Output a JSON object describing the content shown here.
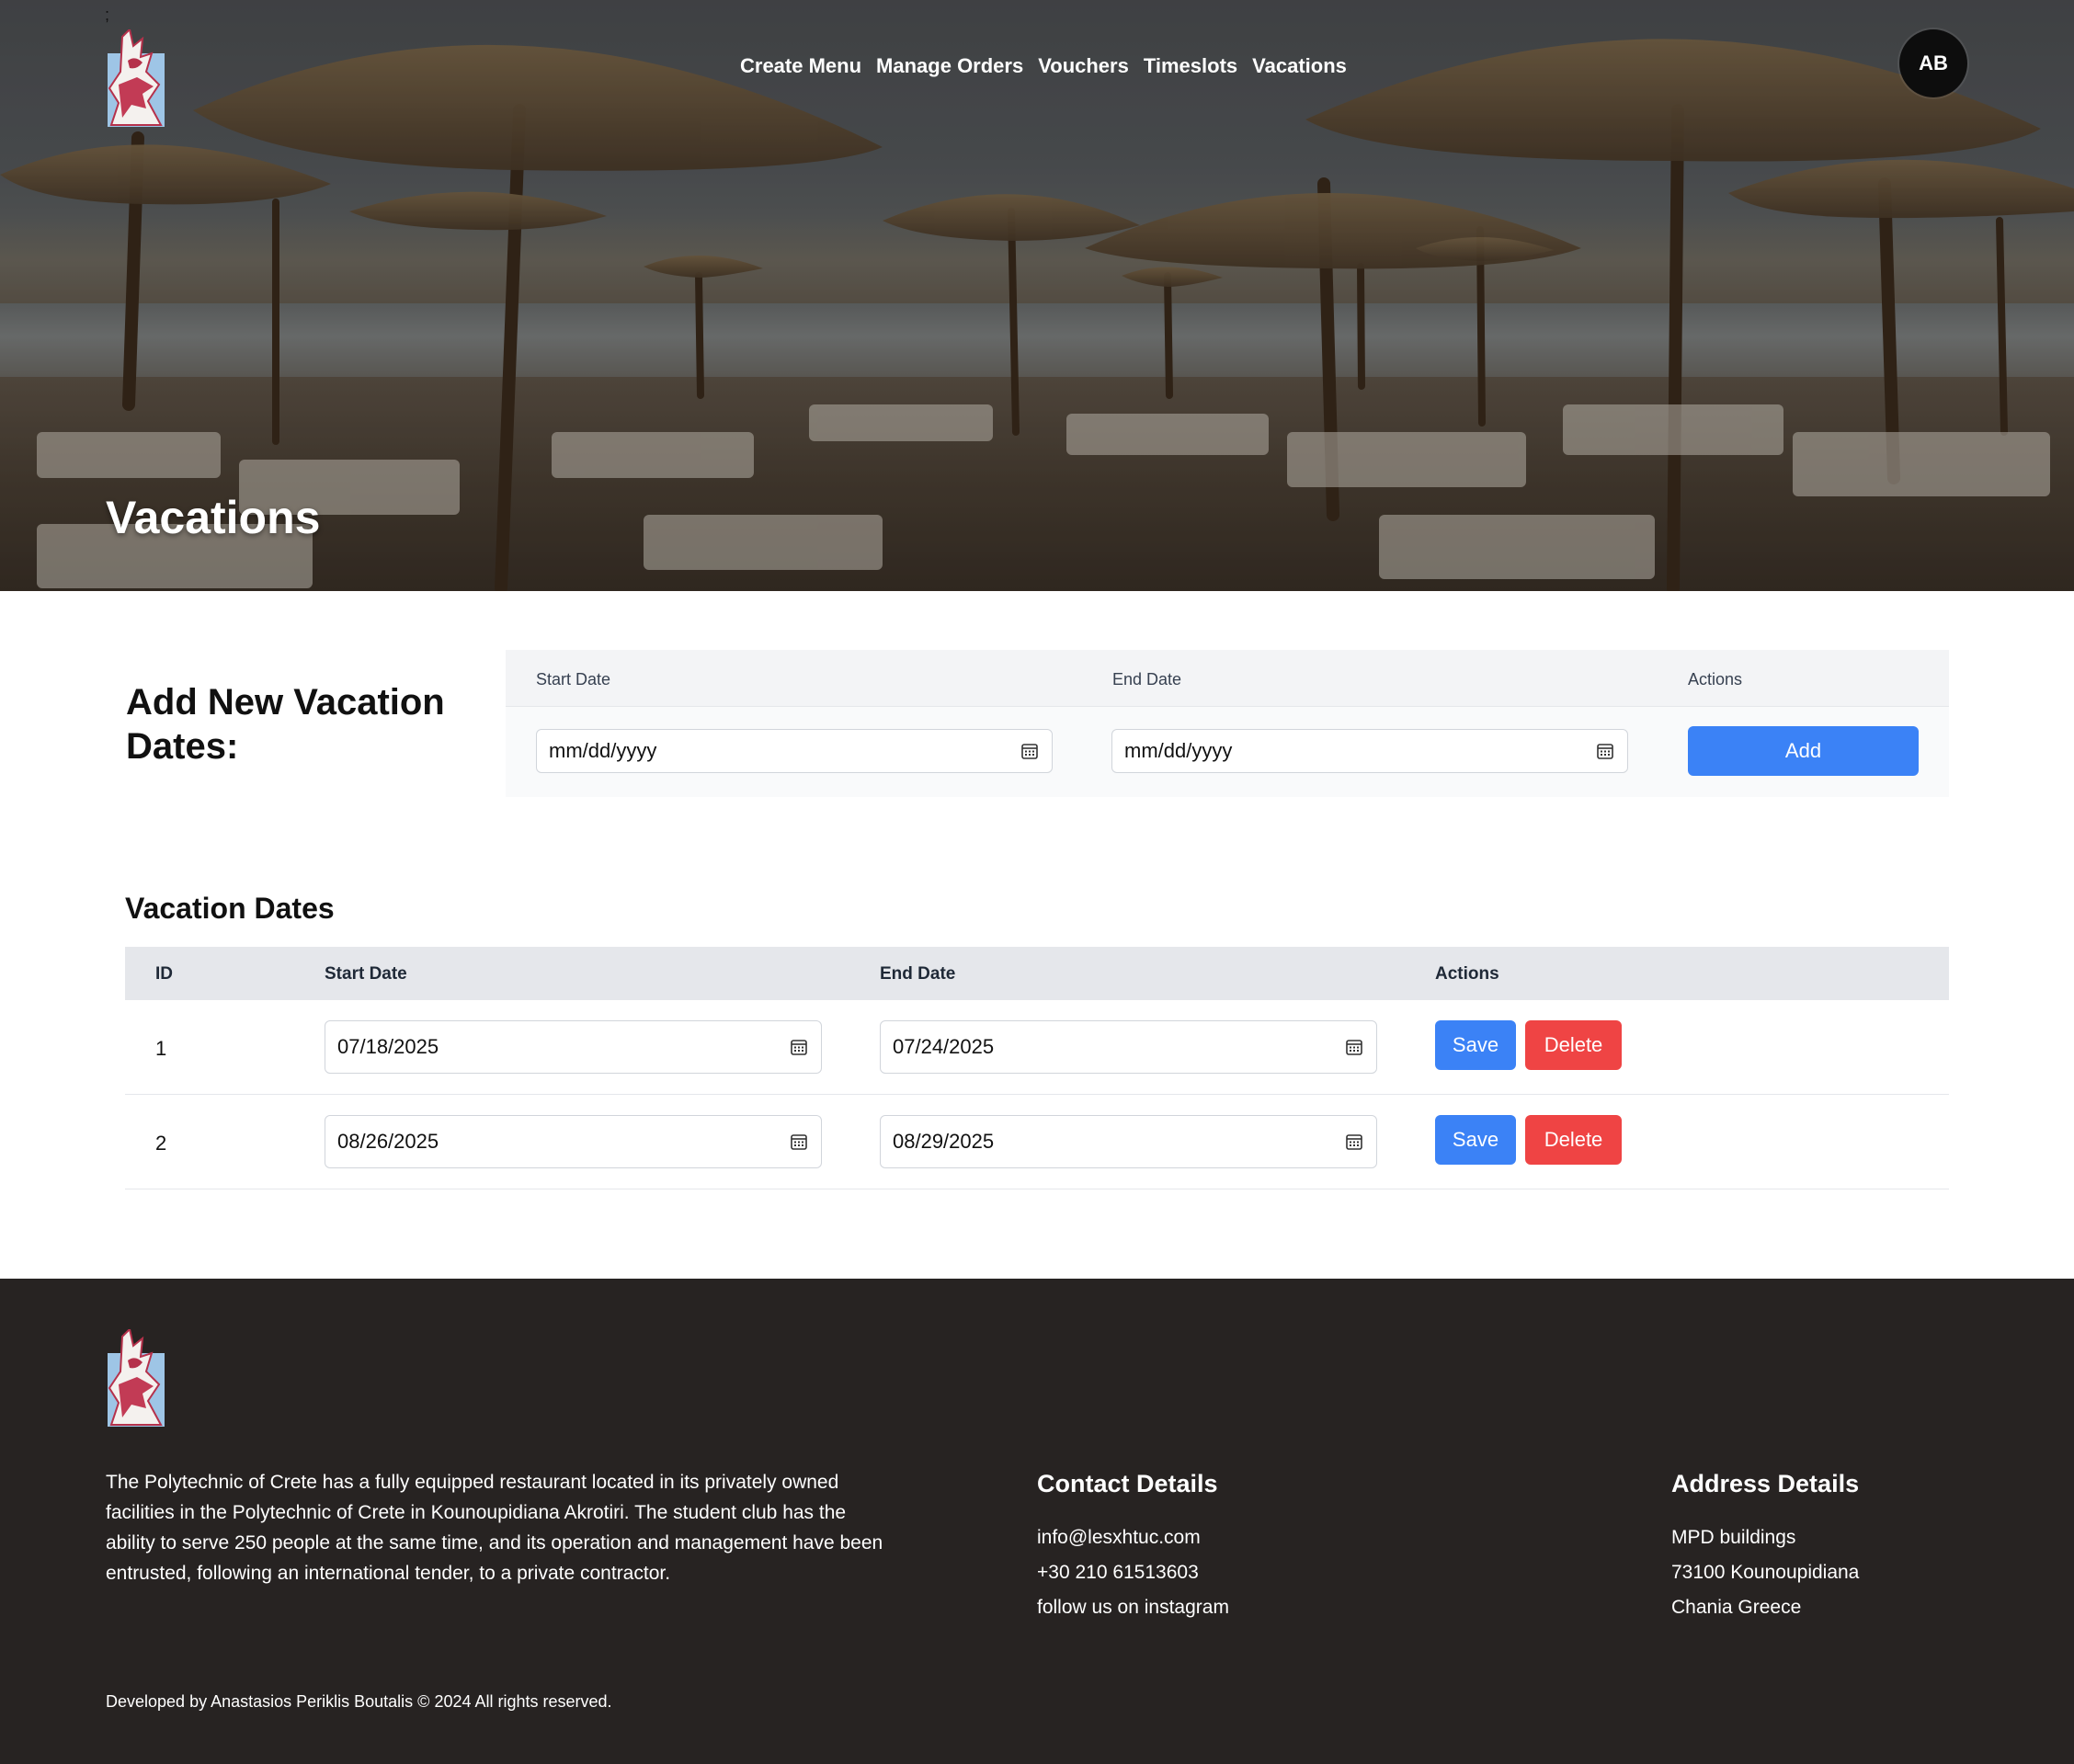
{
  "header": {
    "stray_char": ";",
    "nav": [
      "Create Menu",
      "Manage Orders",
      "Vouchers",
      "Timeslots",
      "Vacations"
    ],
    "avatar_initials": "AB",
    "page_title": "Vacations"
  },
  "add_form": {
    "heading": "Add New Vacation Dates:",
    "col_start": "Start Date",
    "col_end": "End Date",
    "col_actions": "Actions",
    "start_value": "mm/dd/yyyy",
    "end_value": "mm/dd/yyyy",
    "add_label": "Add"
  },
  "vacations": {
    "heading": "Vacation Dates",
    "columns": [
      "ID",
      "Start Date",
      "End Date",
      "Actions"
    ],
    "rows": [
      {
        "id": "1",
        "start": "07/18/2025",
        "end": "07/24/2025"
      },
      {
        "id": "2",
        "start": "08/26/2025",
        "end": "08/29/2025"
      }
    ],
    "save_label": "Save",
    "delete_label": "Delete"
  },
  "footer": {
    "about": "The Polytechnic of Crete has a fully equipped restaurant located in its privately owned facilities in the Polytechnic of Crete in Kounoupidiana Akrotiri. The student club has the ability to serve 250 people at the same time, and its operation and management have been entrusted, following an international tender, to a private contractor.",
    "contact_heading": "Contact Details",
    "contact_lines": [
      "info@lesxhtuc.com",
      "+30 210 61513603",
      "follow us on instagram"
    ],
    "address_heading": "Address Details",
    "address_lines": [
      "MPD buildings",
      "73100 Kounoupidiana",
      "Chania Greece"
    ],
    "copyright": "Developed by Anastasios Periklis Boutalis © 2024 All rights reserved."
  },
  "colors": {
    "primary": "#3b82f6",
    "danger": "#ef4444",
    "footer_bg": "#272322"
  }
}
